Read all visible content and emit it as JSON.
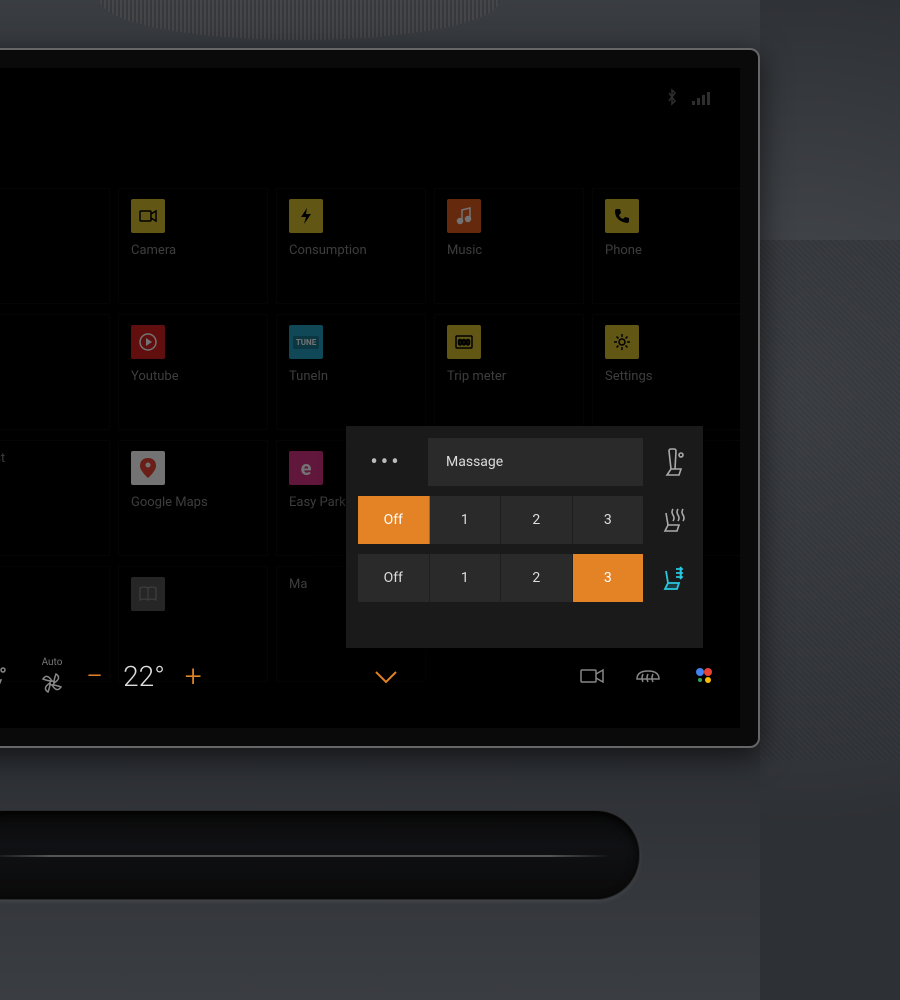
{
  "status": {
    "bluetooth": "bluetooth-icon",
    "signal": "signal-icon"
  },
  "apps": [
    {
      "label": "",
      "color": "",
      "glyph": ""
    },
    {
      "label": "Camera",
      "color": "#d8bf2e",
      "glyph": "video"
    },
    {
      "label": "Consumption",
      "color": "#d8bf2e",
      "glyph": "bolt"
    },
    {
      "label": "Music",
      "color": "#e05c20",
      "glyph": "music"
    },
    {
      "label": "Phone",
      "color": "#d8bf2e",
      "glyph": "phone"
    },
    {
      "label": "",
      "color": "",
      "glyph": ""
    },
    {
      "label": "Youtube",
      "color": "#d62020",
      "glyph": "play"
    },
    {
      "label": "TuneIn",
      "color": "#24a0c4",
      "glyph": "tunein"
    },
    {
      "label": "Trip meter",
      "color": "#d8bf2e",
      "glyph": "meter"
    },
    {
      "label": "Settings",
      "color": "#d8bf2e",
      "glyph": "gear"
    },
    {
      "label": "dcast",
      "color": "",
      "glyph": ""
    },
    {
      "label": "Google Maps",
      "color": "#ffffff",
      "glyph": "pin"
    },
    {
      "label": "Easy Park",
      "color": "#d63384",
      "glyph": "e"
    },
    {
      "label": "",
      "color": "",
      "glyph": ""
    },
    {
      "label": "",
      "color": "",
      "glyph": ""
    },
    {
      "label": "",
      "color": "",
      "glyph": ""
    },
    {
      "label": "",
      "color": "#555",
      "glyph": "book"
    },
    {
      "label": "Ma",
      "color": "",
      "glyph": ""
    }
  ],
  "popup": {
    "massage_label": "Massage",
    "heat": {
      "options": [
        "Off",
        "1",
        "2",
        "3"
      ],
      "active": 0
    },
    "vent": {
      "options": [
        "Off",
        "1",
        "2",
        "3"
      ],
      "active": 3
    }
  },
  "climate": {
    "auto_label": "Auto",
    "temperature": "22°"
  }
}
